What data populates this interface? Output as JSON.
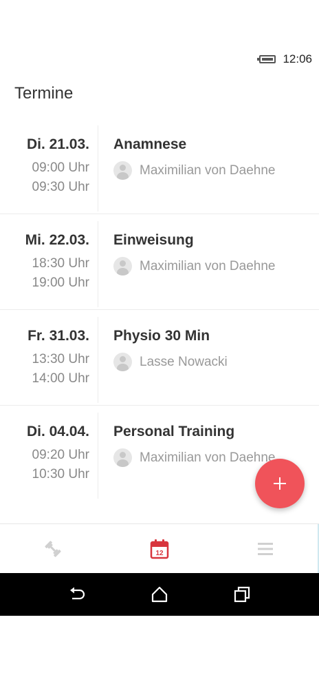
{
  "status_bar": {
    "time": "12:06",
    "battery_icon": "battery-full-icon"
  },
  "header": {
    "title": "Termine"
  },
  "appointments": [
    {
      "date": "Di. 21.03.",
      "start": "09:00 Uhr",
      "end": "09:30 Uhr",
      "title": "Anamnese",
      "person": "Maximilian von Daehne"
    },
    {
      "date": "Mi. 22.03.",
      "start": "18:30 Uhr",
      "end": "19:00 Uhr",
      "title": "Einweisung",
      "person": "Maximilian von Daehne"
    },
    {
      "date": "Fr. 31.03.",
      "start": "13:30 Uhr",
      "end": "14:00 Uhr",
      "title": "Physio 30 Min",
      "person": "Lasse Nowacki"
    },
    {
      "date": "Di. 04.04.",
      "start": "09:20 Uhr",
      "end": "10:30 Uhr",
      "title": "Personal Training",
      "person": "Maximilian von Daehne"
    }
  ],
  "fab": {
    "icon": "plus-icon",
    "color": "#f0535a"
  },
  "bottom_nav": {
    "items": [
      {
        "icon": "dumbbell-icon",
        "active": false
      },
      {
        "icon": "calendar-icon",
        "label": "12",
        "active": true
      },
      {
        "icon": "menu-icon",
        "active": false
      }
    ],
    "active_color": "#d8353d",
    "inactive_color": "#d0d0d0"
  },
  "system_nav": {
    "icons": [
      "back-icon",
      "home-icon",
      "recents-icon"
    ]
  }
}
